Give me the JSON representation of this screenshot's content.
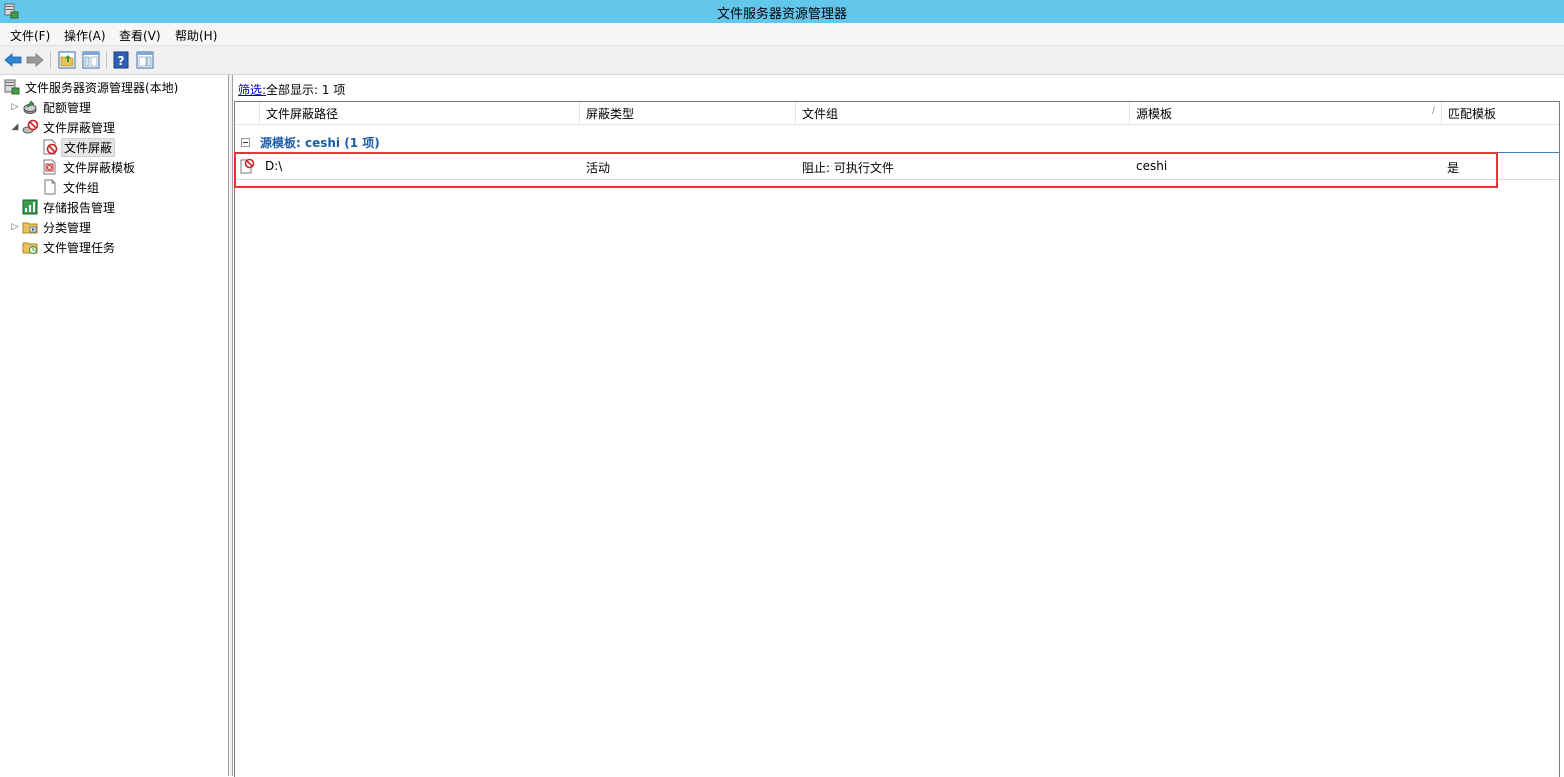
{
  "window": {
    "title": "文件服务器资源管理器"
  },
  "menubar": {
    "items": [
      "文件(F)",
      "操作(A)",
      "查看(V)",
      "帮助(H)"
    ]
  },
  "toolbar": {
    "buttons": [
      "back-arrow-icon",
      "forward-arrow-icon",
      "up-folder-icon",
      "show-hide-tree-icon",
      "help-icon",
      "action-pane-icon"
    ]
  },
  "tree": {
    "root": "文件服务器资源管理器(本地)",
    "nodes": [
      {
        "label": "配额管理",
        "expandable": true,
        "expanded": false
      },
      {
        "label": "文件屏蔽管理",
        "expandable": true,
        "expanded": true
      },
      {
        "label": "文件屏蔽",
        "selected": true
      },
      {
        "label": "文件屏蔽模板"
      },
      {
        "label": "文件组"
      },
      {
        "label": "存储报告管理"
      },
      {
        "label": "分类管理",
        "expandable": true,
        "expanded": false
      },
      {
        "label": "文件管理任务"
      }
    ]
  },
  "content": {
    "filter_link": "筛选:",
    "filter_status": "全部显示: 1 项",
    "columns": [
      "文件屏蔽路径",
      "屏蔽类型",
      "文件组",
      "源模板",
      "匹配模板"
    ],
    "group": {
      "title": "源模板: ceshi (1 项)"
    },
    "rows": [
      {
        "path": "D:\\",
        "screen_type": "活动",
        "file_group": "阻止: 可执行文件",
        "source_template": "ceshi",
        "matches_template": "是"
      }
    ]
  },
  "colors": {
    "titlebar": "#63c7ec",
    "group_title": "#1e5fa8",
    "highlight": "#e8333b",
    "link": "#0000cc"
  }
}
